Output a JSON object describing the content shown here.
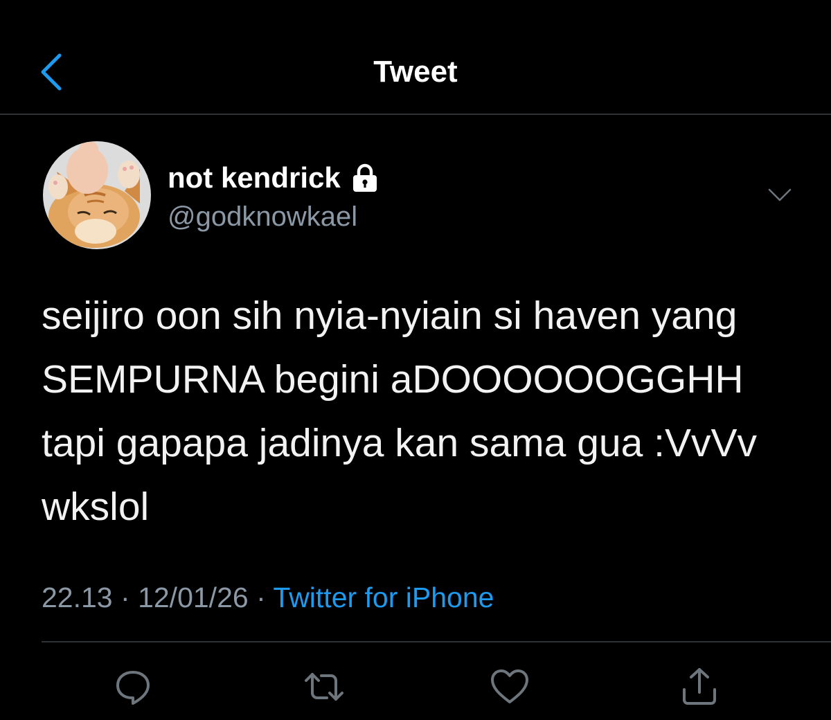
{
  "header": {
    "title": "Tweet",
    "back_icon": "chevron-left-icon",
    "accent_color": "#1d9bf0"
  },
  "tweet": {
    "author": {
      "display_name": "not kendrick",
      "handle": "@godknowkael",
      "protected": true,
      "protected_icon": "lock-icon",
      "avatar_icon": "cat-avatar-icon"
    },
    "more_icon": "chevron-down-icon",
    "text": "seijiro oon sih nyia-nyiain si haven yang SEMPURNA begini aDOOOOOOGGHH tapi gapapa jadinya kan sama gua :VvVv wkslol",
    "time": "22.13",
    "separator": "·",
    "date": "12/01/26",
    "source": "Twitter for iPhone"
  },
  "actions": [
    {
      "name": "reply",
      "icon": "reply-icon"
    },
    {
      "name": "retweet",
      "icon": "retweet-icon"
    },
    {
      "name": "like",
      "icon": "heart-icon"
    },
    {
      "name": "share",
      "icon": "share-icon"
    }
  ],
  "colors": {
    "background": "#000000",
    "text": "#ffffff",
    "secondary_text": "#8b98a5",
    "divider": "#2f3336",
    "link": "#1d9bf0"
  }
}
